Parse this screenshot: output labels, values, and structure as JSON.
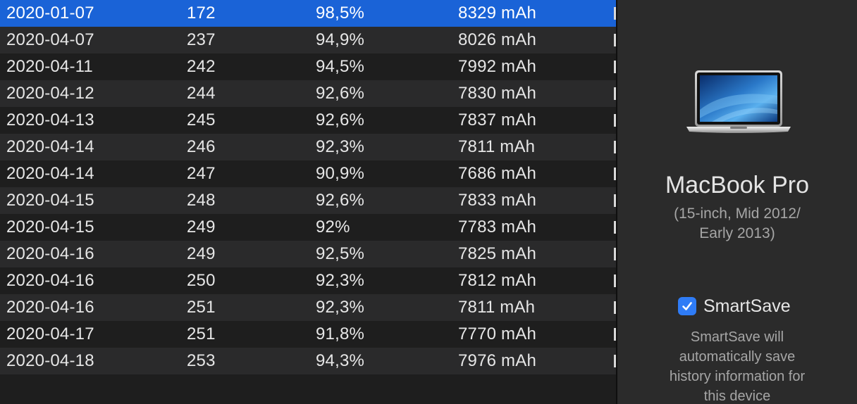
{
  "history": {
    "rows": [
      {
        "date": "2020-01-07",
        "cycles": "172",
        "health": "98,5%",
        "capacity": "8329 mAh",
        "selected": true
      },
      {
        "date": "2020-04-07",
        "cycles": "237",
        "health": "94,9%",
        "capacity": "8026 mAh"
      },
      {
        "date": "2020-04-11",
        "cycles": "242",
        "health": "94,5%",
        "capacity": "7992 mAh"
      },
      {
        "date": "2020-04-12",
        "cycles": "244",
        "health": "92,6%",
        "capacity": "7830 mAh"
      },
      {
        "date": "2020-04-13",
        "cycles": "245",
        "health": "92,6%",
        "capacity": "7837 mAh"
      },
      {
        "date": "2020-04-14",
        "cycles": "246",
        "health": "92,3%",
        "capacity": "7811 mAh"
      },
      {
        "date": "2020-04-14",
        "cycles": "247",
        "health": "90,9%",
        "capacity": "7686 mAh"
      },
      {
        "date": "2020-04-15",
        "cycles": "248",
        "health": "92,6%",
        "capacity": "7833 mAh"
      },
      {
        "date": "2020-04-15",
        "cycles": "249",
        "health": "92%",
        "capacity": "7783 mAh"
      },
      {
        "date": "2020-04-16",
        "cycles": "249",
        "health": "92,5%",
        "capacity": "7825 mAh"
      },
      {
        "date": "2020-04-16",
        "cycles": "250",
        "health": "92,3%",
        "capacity": "7812 mAh"
      },
      {
        "date": "2020-04-16",
        "cycles": "251",
        "health": "92,3%",
        "capacity": "7811 mAh"
      },
      {
        "date": "2020-04-17",
        "cycles": "251",
        "health": "91,8%",
        "capacity": "7770 mAh"
      },
      {
        "date": "2020-04-18",
        "cycles": "253",
        "health": "94,3%",
        "capacity": "7976 mAh"
      }
    ]
  },
  "device": {
    "name": "MacBook Pro",
    "model_line1": "(15-inch, Mid 2012/",
    "model_line2": "Early 2013)",
    "icon": "laptop-icon"
  },
  "smartsave": {
    "label": "SmartSave",
    "checked": true,
    "description_lines": [
      "SmartSave will",
      "automatically save",
      "history information for",
      "this device"
    ]
  },
  "colors": {
    "selection": "#1a63d7",
    "checkbox": "#2f7cf6",
    "panel_bg": "#2b2b2b",
    "table_bg": "#1e1e1e",
    "row_alt_bg": "#2a2a2b"
  }
}
